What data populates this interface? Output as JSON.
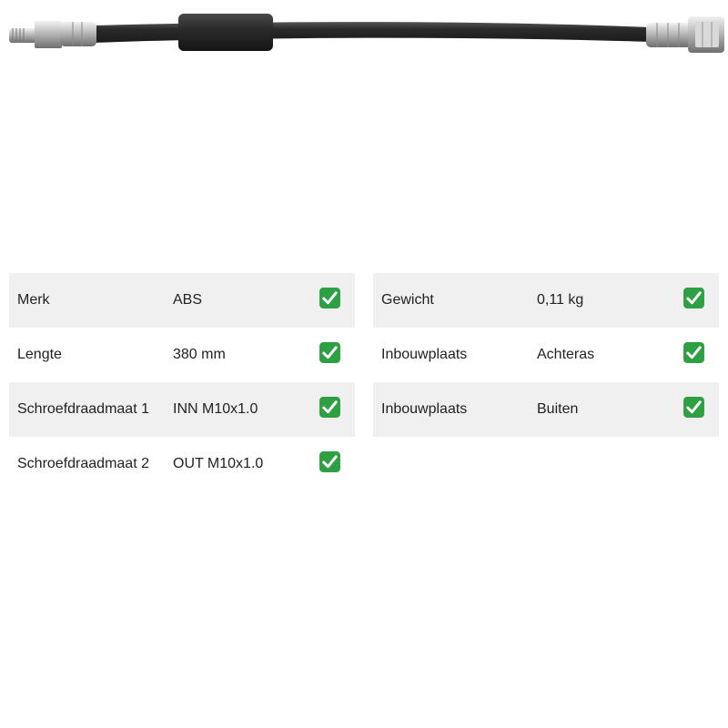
{
  "specs_left": [
    {
      "label": "Merk",
      "value": "ABS",
      "status_icon": "check-mark-icon"
    },
    {
      "label": "Lengte",
      "value": "380 mm",
      "status_icon": "check-mark-icon"
    },
    {
      "label": "Schroefdraadmaat 1",
      "value": "INN M10x1.0",
      "status_icon": "check-mark-icon"
    },
    {
      "label": "Schroefdraadmaat 2",
      "value": "OUT M10x1.0",
      "status_icon": "check-mark-icon"
    }
  ],
  "specs_right": [
    {
      "label": "Gewicht",
      "value": "0,11 kg",
      "status_icon": "check-mark-icon"
    },
    {
      "label": "Inbouwplaats",
      "value": "Achteras",
      "status_icon": "check-mark-icon"
    },
    {
      "label": "Inbouwplaats",
      "value": "Buiten",
      "status_icon": "check-mark-icon"
    }
  ],
  "colors": {
    "row_shade": "#f0f0f0",
    "check_green": "#2ea043",
    "hose_black": "#2a2a2a"
  }
}
